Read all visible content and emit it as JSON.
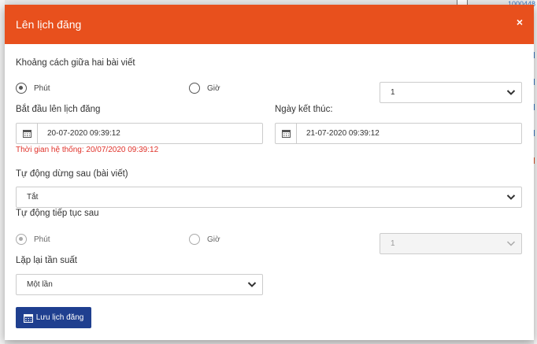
{
  "background": {
    "top_right_link": "1000448"
  },
  "modal": {
    "title": "Lên lịch đăng",
    "close_symbol": "×",
    "interval": {
      "label": "Khoảng cách giữa hai bài viết",
      "options": [
        {
          "label": "Phút",
          "checked": true
        },
        {
          "label": "Giờ",
          "checked": false
        }
      ],
      "select_value": "1"
    },
    "start": {
      "label": "Bắt đầu lên lịch đăng",
      "value": "20-07-2020 09:39:12",
      "system_time": "Thời gian hệ thống: 20/07/2020 09:39:12"
    },
    "end": {
      "label": "Ngày kết thúc:",
      "value": "21-07-2020 09:39:12"
    },
    "auto_stop": {
      "label": "Tự động dừng sau (bài viết)",
      "value": "Tắt"
    },
    "auto_continue": {
      "label": "Tự động tiếp tục sau",
      "options": [
        {
          "label": "Phút",
          "checked": true
        },
        {
          "label": "Giờ",
          "checked": false
        }
      ],
      "select_value": "1"
    },
    "repeat": {
      "label": "Lặp lại tần suất",
      "value": "Một lần"
    },
    "save_button": "Lưu lịch đăng"
  },
  "colors": {
    "header": "#e8501d",
    "button": "#1f3f8f",
    "error": "#e0322a"
  },
  "icons": [
    "close-icon",
    "calendar-icon",
    "chevron-down-icon"
  ]
}
